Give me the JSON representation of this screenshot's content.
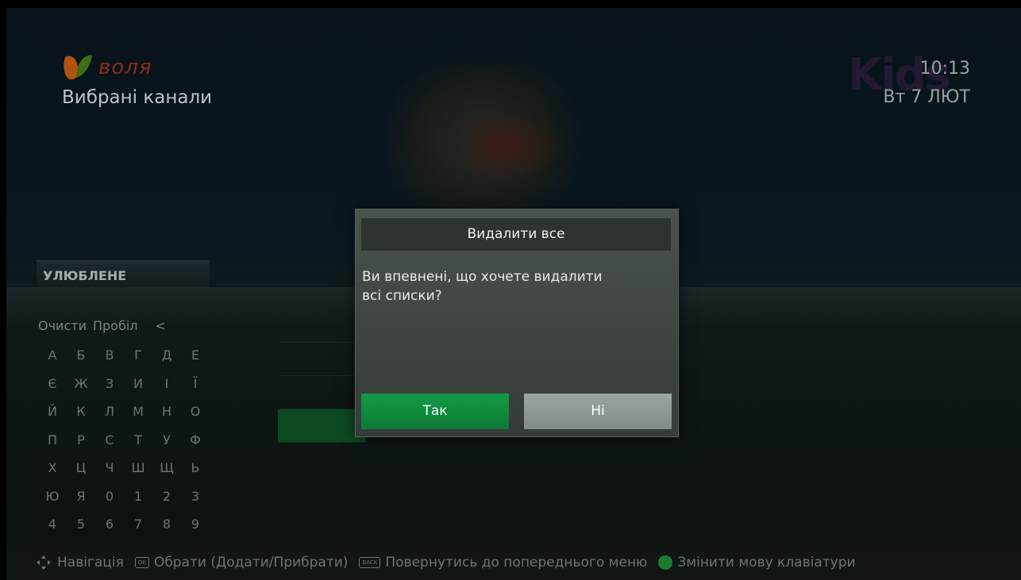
{
  "header": {
    "brand": "воля",
    "title": "Вибрані канали",
    "time": "10:13",
    "date": "Вт 7 ЛЮТ",
    "channel_logo": "Kids"
  },
  "favorites": {
    "label": "УЛЮБЛЕНЕ"
  },
  "keyboard": {
    "clear_label": "Очисти",
    "space_label": "Пробіл",
    "backspace_label": "<",
    "rows": [
      [
        "А",
        "Б",
        "В",
        "Г",
        "Д",
        "Е"
      ],
      [
        "Є",
        "Ж",
        "З",
        "И",
        "І",
        "Ї"
      ],
      [
        "Й",
        "К",
        "Л",
        "М",
        "Н",
        "О"
      ],
      [
        "П",
        "Р",
        "С",
        "Т",
        "У",
        "Ф"
      ],
      [
        "Х",
        "Ц",
        "Ч",
        "Ш",
        "Щ",
        "Ь"
      ],
      [
        "Ю",
        "Я",
        "0",
        "1",
        "2",
        "3"
      ],
      [
        "4",
        "5",
        "6",
        "7",
        "8",
        "9"
      ]
    ]
  },
  "dialog": {
    "title": "Видалити все",
    "message_line1": "Ви впевнені, що хочете видалити",
    "message_line2": "всі списки?",
    "yes_label": "Так",
    "no_label": "Ні"
  },
  "hints": {
    "navigate": "Навігація",
    "ok_icon": "OK",
    "select": "Обрати (Додати/Прибрати)",
    "back_icon": "BACK",
    "back": "Повернутись до попереднього меню",
    "change_lang": "Змінити мову клавіатури"
  },
  "colors": {
    "accent_green": "#139c45",
    "brand_orange": "#8a2d14"
  }
}
